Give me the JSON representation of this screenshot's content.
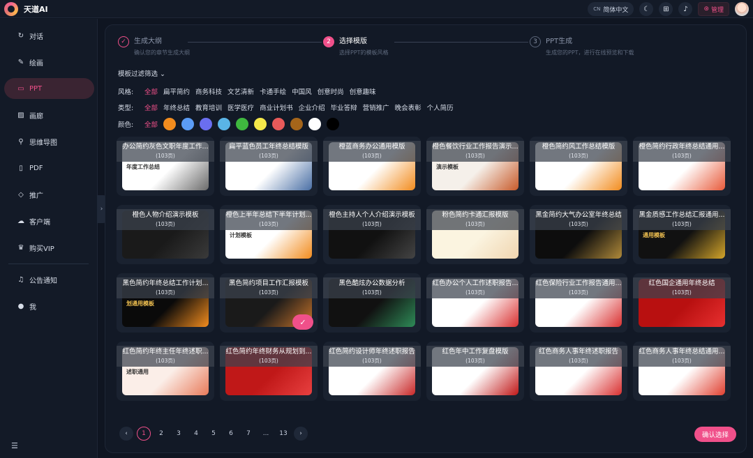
{
  "app": {
    "title": "天道AI"
  },
  "topbar": {
    "lang_code": "CN",
    "lang_label": "简体中文",
    "admin_label": "管理"
  },
  "sidebar": {
    "items": [
      {
        "label": "对话",
        "icon": "refresh-icon",
        "glyph": "↻"
      },
      {
        "label": "绘画",
        "icon": "brush-icon",
        "glyph": "✎"
      },
      {
        "label": "PPT",
        "icon": "slides-icon",
        "glyph": "▭",
        "active": true
      },
      {
        "label": "画廊",
        "icon": "gallery-icon",
        "glyph": "▨"
      },
      {
        "label": "思维导图",
        "icon": "mindmap-icon",
        "glyph": "⚲"
      },
      {
        "label": "PDF",
        "icon": "pdf-icon",
        "glyph": "▯"
      },
      {
        "label": "推广",
        "icon": "diamond-icon",
        "glyph": "◇"
      },
      {
        "label": "客户端",
        "icon": "cloud-icon",
        "glyph": "☁"
      },
      {
        "label": "购买VIP",
        "icon": "crown-icon",
        "glyph": "♛"
      }
    ],
    "bottom_items": [
      {
        "label": "公告通知",
        "icon": "bell-icon",
        "glyph": "♫"
      },
      {
        "label": "我",
        "icon": "user-icon",
        "glyph": "●"
      }
    ],
    "menu_toggle": "☰"
  },
  "steps": [
    {
      "num": "✓",
      "title": "生成大纲",
      "desc": "确认您的章节生成大纲",
      "state": "done"
    },
    {
      "num": "2",
      "title": "选择模版",
      "desc": "选择PPT的模板风格",
      "state": "current"
    },
    {
      "num": "3",
      "title": "PPT生成",
      "desc": "生成您的PPT，进行在线预览和下载",
      "state": "todo"
    }
  ],
  "filters": {
    "toggle_label": "模板过滤筛选 ⌄",
    "style": {
      "label": "风格:",
      "options": [
        "全部",
        "扁平简约",
        "商务科技",
        "文艺清新",
        "卡通手绘",
        "中国风",
        "创意时尚",
        "创意趣味"
      ],
      "selected": 0
    },
    "type": {
      "label": "类型:",
      "options": [
        "全部",
        "年终总结",
        "教育培训",
        "医学医疗",
        "商业计划书",
        "企业介绍",
        "毕业答辩",
        "营销推广",
        "晚会表彰",
        "个人简历"
      ],
      "selected": 0
    },
    "color": {
      "label": "颜色:",
      "all": "全部",
      "swatches": [
        "#f28c1e",
        "#5b9cf5",
        "#6a6ef0",
        "#5ab4e6",
        "#3fb83f",
        "#f5e84a",
        "#e85a5a",
        "#a5651a",
        "#ffffff",
        "#000000"
      ]
    }
  },
  "templates": [
    {
      "title": "办公简约灰色文职年度工作...",
      "pages": "(103页)",
      "thumb": [
        "#ffffff",
        "#6b6b6b"
      ],
      "thumb_text": "年度工作总结"
    },
    {
      "title": "扁平蓝色员工年终总结模版",
      "pages": "(103页)",
      "thumb": [
        "#ffffff",
        "#4a6fa5"
      ],
      "thumb_text": ""
    },
    {
      "title": "橙蓝商务办公通用模版",
      "pages": "(103页)",
      "thumb": [
        "#ffffff",
        "#f28c1e"
      ],
      "thumb_text": ""
    },
    {
      "title": "橙色餐饮行业工作报告演示...",
      "pages": "(103页)",
      "thumb": [
        "#f5f0ea",
        "#c85a2a"
      ],
      "thumb_text": "演示模板"
    },
    {
      "title": "橙色简约风工作总结模版",
      "pages": "(103页)",
      "thumb": [
        "#ffffff",
        "#f28c1e"
      ],
      "thumb_text": ""
    },
    {
      "title": "橙色简约行政年终总结通用...",
      "pages": "(103页)",
      "thumb": [
        "#ffffff",
        "#e85a3a"
      ],
      "thumb_text": ""
    },
    {
      "title": "橙色人物介绍演示模板",
      "pages": "(103页)",
      "thumb": [
        "#1a1a1a",
        "#3a3a3a"
      ],
      "thumb_text": ""
    },
    {
      "title": "橙色上半年总结下半年计划...",
      "pages": "(103页)",
      "thumb": [
        "#ffffff",
        "#f28c1e"
      ],
      "thumb_text": "计划模板"
    },
    {
      "title": "橙色主持人个人介绍演示模板",
      "pages": "(103页)",
      "thumb": [
        "#111111",
        "#444444"
      ],
      "thumb_text": ""
    },
    {
      "title": "粉色简约卡通汇报模版",
      "pages": "(103页)",
      "thumb": [
        "#fbf4e0",
        "#f0d5b0"
      ],
      "thumb_text": ""
    },
    {
      "title": "黑金简约大气办公室年终总结",
      "pages": "(103页)",
      "thumb": [
        "#0d0d0d",
        "#b08a3a"
      ],
      "thumb_text": ""
    },
    {
      "title": "黑金质感工作总结汇报通用...",
      "pages": "(103页)",
      "thumb": [
        "#111111",
        "#d4a52a"
      ],
      "thumb_text": "通用模板"
    },
    {
      "title": "黑色简约年终总结工作计划...",
      "pages": "(103页)",
      "thumb": [
        "#0a0a0a",
        "#f28c1e"
      ],
      "thumb_text": "划通用模板"
    },
    {
      "title": "黑色简约项目工作汇报模板",
      "pages": "(103页)",
      "thumb": [
        "#1a1a1a",
        "#c8742a"
      ],
      "thumb_text": "",
      "selected": true
    },
    {
      "title": "黑色酷炫办公数据分析",
      "pages": "(103页)",
      "thumb": [
        "#111111",
        "#2e8b57"
      ],
      "thumb_text": ""
    },
    {
      "title": "红色办公个人工作述职报告...",
      "pages": "(103页)",
      "thumb": [
        "#ffffff",
        "#d93030"
      ],
      "thumb_text": ""
    },
    {
      "title": "红色保险行业工作报告通用...",
      "pages": "(103页)",
      "thumb": [
        "#ffffff",
        "#d93030"
      ],
      "thumb_text": ""
    },
    {
      "title": "红色国企通用年终总结",
      "pages": "(103页)",
      "thumb": [
        "#b81010",
        "#e83030"
      ],
      "thumb_text": ""
    },
    {
      "title": "红色简约年终主任年终述职...",
      "pages": "(103页)",
      "thumb": [
        "#fbeee8",
        "#e87a5a"
      ],
      "thumb_text": "述职通用"
    },
    {
      "title": "红色简约年终财务从规划到...",
      "pages": "(103页)",
      "thumb": [
        "#c01818",
        "#e84040"
      ],
      "thumb_text": ""
    },
    {
      "title": "红色简约设计师年终述职报告",
      "pages": "(103页)",
      "thumb": [
        "#ffffff",
        "#c82828"
      ],
      "thumb_text": ""
    },
    {
      "title": "红色年中工作复盘模版",
      "pages": "(103页)",
      "thumb": [
        "#ffffff",
        "#c01818"
      ],
      "thumb_text": ""
    },
    {
      "title": "红色商务人事年终述职报告",
      "pages": "(103页)",
      "thumb": [
        "#ffffff",
        "#d93030"
      ],
      "thumb_text": ""
    },
    {
      "title": "红色商务人事年终总结通用...",
      "pages": "(103页)",
      "thumb": [
        "#ffffff",
        "#e04030"
      ],
      "thumb_text": ""
    }
  ],
  "pagination": {
    "pages": [
      "1",
      "2",
      "3",
      "4",
      "5",
      "6",
      "7",
      "...",
      "13"
    ],
    "current": "1",
    "prev": "‹",
    "next": "›"
  },
  "confirm_button": "确认选择"
}
